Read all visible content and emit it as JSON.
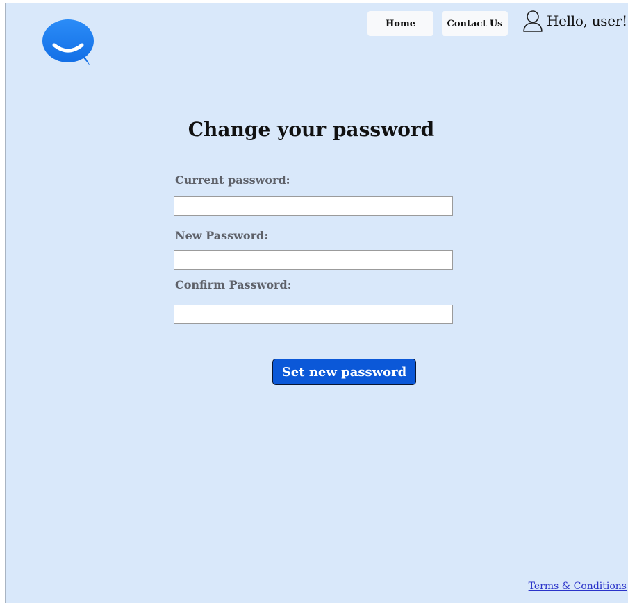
{
  "nav": {
    "home_label": "Home",
    "contact_label": "Contact Us",
    "greeting": "Hello, user!"
  },
  "form": {
    "title": "Change your password",
    "current_label": "Current password:",
    "current_value": "",
    "new_label": "New Password:",
    "new_value": "",
    "confirm_label": "Confirm Password:",
    "confirm_value": "",
    "submit_label": "Set new password"
  },
  "footer": {
    "terms_label": "Terms & Conditions"
  },
  "icons": {
    "logo": "chat-bubble-logo-icon",
    "user": "user-icon"
  },
  "colors": {
    "background": "#d9e8fa",
    "primary_button": "#0b58d8",
    "logo": "#1d7ef2",
    "link": "#2a33c9",
    "label": "#5e6169"
  }
}
